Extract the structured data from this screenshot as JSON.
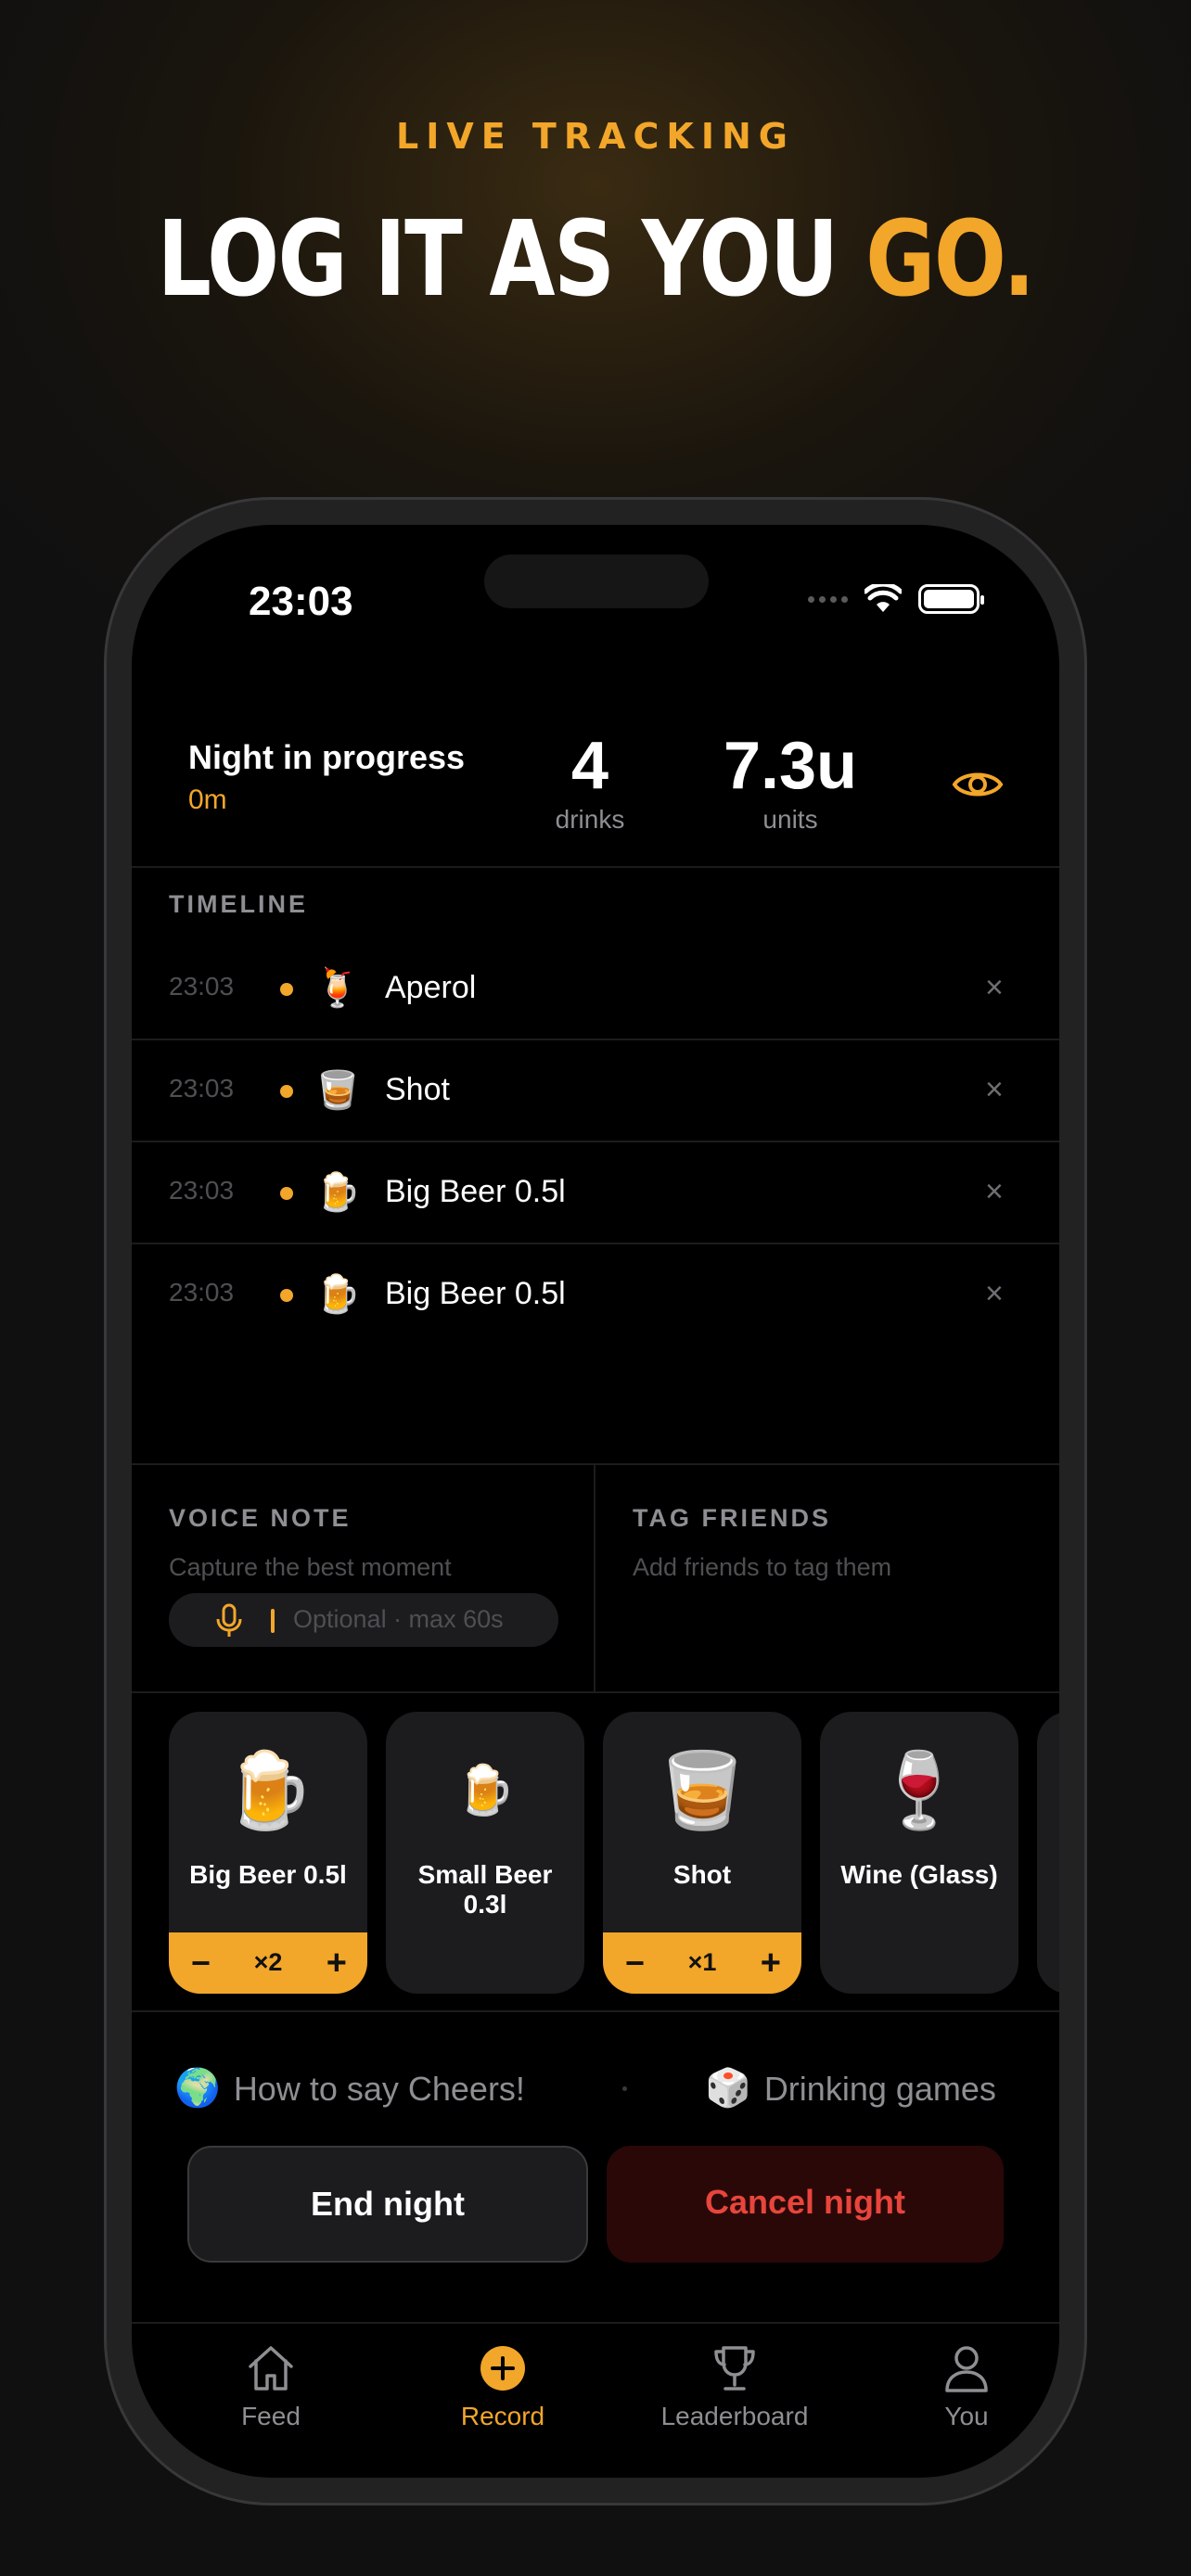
{
  "promo": {
    "kicker": "LIVE TRACKING",
    "headline_main": "LOG IT AS YOU ",
    "headline_accent": "GO."
  },
  "status_bar": {
    "time": "23:03"
  },
  "session": {
    "title": "Night in progress",
    "duration": "0m",
    "drinks_value": "4",
    "drinks_label": "drinks",
    "units_value": "7.3u",
    "units_label": "units"
  },
  "timeline": {
    "header": "TIMELINE",
    "entries": [
      {
        "time": "23:03",
        "emoji": "🍹",
        "name": "Aperol",
        "remove": "×"
      },
      {
        "time": "23:03",
        "emoji": "🥃",
        "name": "Shot",
        "remove": "×"
      },
      {
        "time": "23:03",
        "emoji": "🍺",
        "name": "Big Beer 0.5l",
        "remove": "×"
      },
      {
        "time": "23:03",
        "emoji": "🍺",
        "name": "Big Beer 0.5l",
        "remove": "×"
      }
    ]
  },
  "voice_note": {
    "header": "VOICE NOTE",
    "subtitle": "Capture the best moment",
    "hint": "Optional · max 60s"
  },
  "tag_friends": {
    "header": "TAG FRIENDS",
    "subtitle": "Add friends to tag them"
  },
  "drink_cards": [
    {
      "emoji": "🍺",
      "name": "Big Beer 0.5l",
      "count": "×2",
      "minus": "−",
      "plus": "+"
    },
    {
      "emoji": "🍺",
      "name": "Small Beer 0.3l"
    },
    {
      "emoji": "🥃",
      "name": "Shot",
      "count": "×1",
      "minus": "−",
      "plus": "+"
    },
    {
      "emoji": "🍷",
      "name": "Wine (Glass)"
    }
  ],
  "links": {
    "cheers_emoji": "🌍",
    "cheers": "How to say Cheers!",
    "games_emoji": "🎲",
    "games": "Drinking games"
  },
  "actions": {
    "end_night": "End night",
    "cancel_night": "Cancel night"
  },
  "tabs": [
    {
      "label": "Feed",
      "icon": "home-icon"
    },
    {
      "label": "Record",
      "icon": "plus-circle-icon"
    },
    {
      "label": "Leaderboard",
      "icon": "trophy-icon"
    },
    {
      "label": "You",
      "icon": "person-icon"
    }
  ],
  "colors": {
    "accent": "#f2a62a",
    "danger": "#e8453c",
    "card": "#1c1c1e",
    "muted": "#8e8e93"
  }
}
